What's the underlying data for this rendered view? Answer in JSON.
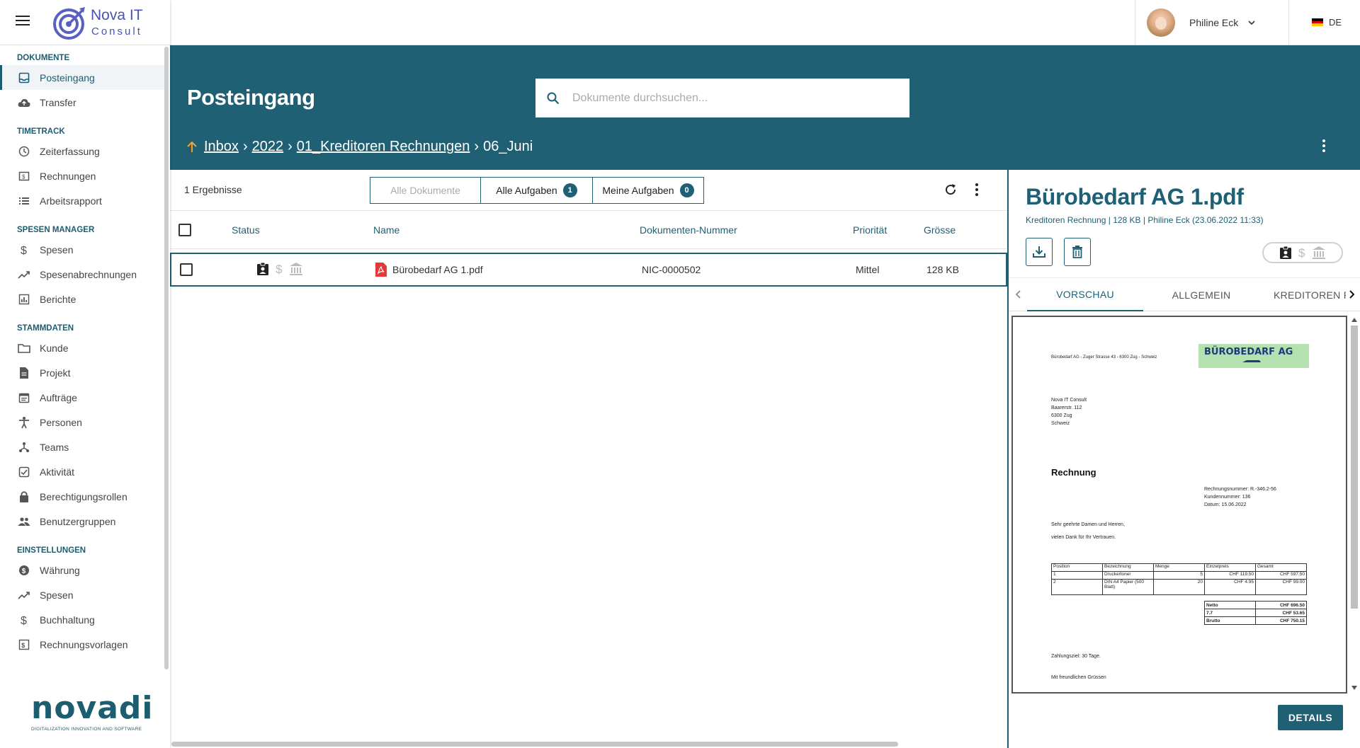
{
  "app": {
    "logo_line1": "Nova IT",
    "logo_line2": "Consult",
    "brand_color": "#1f6074",
    "footer_logo": "novadi",
    "footer_tagline": "DIGITALIZATION INNOVATION  AND SOFTWARE"
  },
  "topbar": {
    "user_name": "Philine Eck",
    "language": "DE"
  },
  "sidebar": {
    "sections": [
      {
        "title": "DOKUMENTE",
        "items": [
          {
            "label": "Posteingang",
            "icon": "inbox-icon",
            "active": true
          },
          {
            "label": "Transfer",
            "icon": "cloud-upload-icon"
          }
        ]
      },
      {
        "title": "TIMETRACK",
        "items": [
          {
            "label": "Zeiterfassung",
            "icon": "clock-icon"
          },
          {
            "label": "Rechnungen",
            "icon": "invoice-icon"
          },
          {
            "label": "Arbeitsrapport",
            "icon": "list-icon"
          }
        ]
      },
      {
        "title": "SPESEN MANAGER",
        "items": [
          {
            "label": "Spesen",
            "icon": "dollar-icon"
          },
          {
            "label": "Spesenabrechnungen",
            "icon": "trending-icon"
          },
          {
            "label": "Berichte",
            "icon": "bar-chart-icon"
          }
        ]
      },
      {
        "title": "STAMMDATEN",
        "items": [
          {
            "label": "Kunde",
            "icon": "folder-icon"
          },
          {
            "label": "Projekt",
            "icon": "document-icon"
          },
          {
            "label": "Aufträge",
            "icon": "calendar-icon"
          },
          {
            "label": "Personen",
            "icon": "person-icon"
          },
          {
            "label": "Teams",
            "icon": "hierarchy-icon"
          },
          {
            "label": "Aktivität",
            "icon": "activity-icon"
          },
          {
            "label": "Berechtigungsrollen",
            "icon": "lock-icon"
          },
          {
            "label": "Benutzergruppen",
            "icon": "group-icon"
          }
        ]
      },
      {
        "title": "EINSTELLUNGEN",
        "items": [
          {
            "label": "Währung",
            "icon": "currency-icon"
          },
          {
            "label": "Spesen",
            "icon": "trending-icon"
          },
          {
            "label": "Buchhaltung",
            "icon": "dollar-icon"
          },
          {
            "label": "Rechnungsvorlagen",
            "icon": "template-icon"
          }
        ]
      }
    ]
  },
  "header": {
    "title": "Posteingang",
    "search_placeholder": "Dokumente durchsuchen...",
    "breadcrumb": [
      "Inbox",
      "2022",
      "01_Kreditoren Rechnungen"
    ],
    "breadcrumb_current": "06_Juni"
  },
  "list": {
    "result_count": "1 Ergebnisse",
    "filters": [
      {
        "label": "Alle Dokumente",
        "badge": null,
        "disabled": true
      },
      {
        "label": "Alle Aufgaben",
        "badge": "1"
      },
      {
        "label": "Meine Aufgaben",
        "badge": "0"
      }
    ],
    "columns": [
      "Status",
      "Name",
      "Dokumenten-Nummer",
      "Priorität",
      "Grösse"
    ],
    "rows": [
      {
        "name": "Bürobedarf AG 1.pdf",
        "number": "NIC-0000502",
        "priority": "Mittel",
        "size": "128 KB"
      }
    ]
  },
  "detail": {
    "title": "Bürobedarf AG 1.pdf",
    "meta": "Kreditoren Rechnung | 128 KB | Philine Eck (23.06.2022 11:33)",
    "tabs": [
      "VORSCHAU",
      "ALLGEMEIN",
      "KREDITOREN R"
    ],
    "active_tab": "VORSCHAU",
    "details_button": "DETAILS"
  },
  "invoice": {
    "sender_line": "Bürobedarf AG - Zuger Strasse 43 - 6300 Zug - Schweiz",
    "logo_text": "BÜROBEDARF AG",
    "recipient": [
      "Nova IT Consult",
      "Baarerstr. 112",
      "6300 Zug",
      "Schweiz"
    ],
    "heading": "Rechnung",
    "meta": [
      "Rechnungsnummer: R.-346.2-56",
      "Kundennummer: 136",
      "Datum: 15.06.2022"
    ],
    "greeting": "Sehr geehrte Damen und Herren,",
    "thanks": "vielen Dank für Ihr Vertrauen.",
    "table_headers": [
      "Position",
      "Bezeichnung",
      "Menge",
      "Einzelpreis",
      "Gesamt"
    ],
    "table_rows": [
      [
        "1",
        "Druckertoner",
        "5",
        "CHF 119.50",
        "CHF 597.50"
      ],
      [
        "2",
        "DIN A4 Papier (500 Blatt)",
        "20",
        "CHF 4.95",
        "CHF 99.00"
      ]
    ],
    "totals": [
      [
        "Netto",
        "CHF 696.50"
      ],
      [
        "7.7",
        "CHF 53.65"
      ],
      [
        "Brutto",
        "CHF 750.15"
      ]
    ],
    "payment": "Zahlungsziel: 30 Tage.",
    "closing": "Mit freundlichen Grüssen"
  }
}
